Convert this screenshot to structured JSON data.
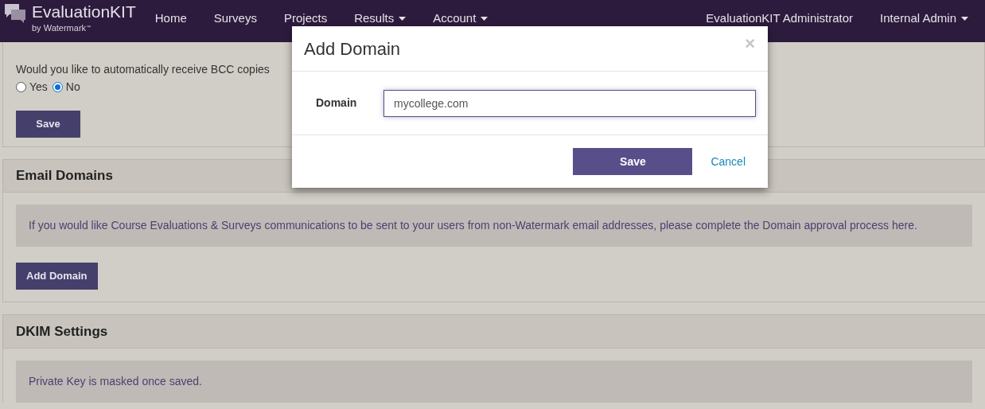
{
  "navbar": {
    "brand": "EvaluationKIT",
    "brand_sub": "by Watermark",
    "trademark": "™",
    "items": [
      {
        "label": "Home",
        "dropdown": false
      },
      {
        "label": "Surveys",
        "dropdown": false
      },
      {
        "label": "Projects",
        "dropdown": false
      },
      {
        "label": "Results",
        "dropdown": true
      },
      {
        "label": "Account",
        "dropdown": true
      }
    ],
    "right_items": [
      {
        "label": "EvaluationKIT Administrator",
        "dropdown": false
      },
      {
        "label": "Internal Admin",
        "dropdown": true
      }
    ]
  },
  "bcc_panel": {
    "question": "Would you like to automatically receive BCC copies",
    "options": [
      {
        "label": "Yes",
        "selected": false
      },
      {
        "label": "No",
        "selected": true
      }
    ],
    "save": "Save"
  },
  "email_domains": {
    "title": "Email Domains",
    "notice": "If you would like Course Evaluations & Surveys communications to be sent to your users from non-Watermark email addresses, please complete the Domain approval process here.",
    "button": "Add Domain"
  },
  "dkim": {
    "title": "DKIM Settings",
    "notice": "Private Key is masked once saved."
  },
  "modal": {
    "title": "Add Domain",
    "close": "×",
    "field_label": "Domain",
    "field_value": "mycollege.com",
    "save": "Save",
    "cancel": "Cancel"
  }
}
